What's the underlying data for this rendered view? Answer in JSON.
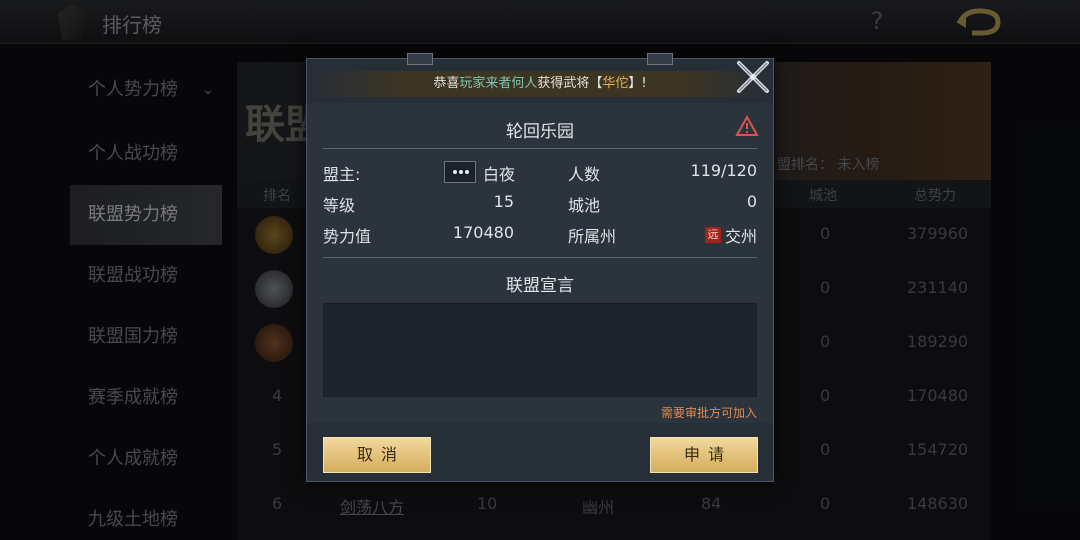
{
  "header": {
    "title": "排行榜",
    "help_label": "?",
    "back_icon": "return-arrow-icon"
  },
  "sidebar": {
    "items": [
      {
        "label": "个人势力榜",
        "active": false
      },
      {
        "label": "个人战功榜",
        "active": false
      },
      {
        "label": "联盟势力榜",
        "active": true
      },
      {
        "label": "联盟战功榜",
        "active": false
      },
      {
        "label": "联盟国力榜",
        "active": false
      },
      {
        "label": "赛季成就榜",
        "active": false
      },
      {
        "label": "个人成就榜",
        "active": false
      },
      {
        "label": "九级土地榜",
        "active": false
      }
    ],
    "chevron": "⌄"
  },
  "banner": {
    "title": "联盟",
    "my_rank": "盟排名： 未入榜"
  },
  "table": {
    "columns": {
      "rank": "排名",
      "city": "城池",
      "total": "总势力"
    },
    "rows": [
      {
        "rank": "",
        "name": "",
        "level": "",
        "region": "",
        "members": "",
        "city": "0",
        "total": "379960"
      },
      {
        "rank": "",
        "name": "",
        "level": "",
        "region": "",
        "members": "",
        "city": "0",
        "total": "231140"
      },
      {
        "rank": "",
        "name": "",
        "level": "",
        "region": "",
        "members": "",
        "city": "0",
        "total": "189290"
      },
      {
        "rank": "4",
        "name": "",
        "level": "",
        "region": "",
        "members": "",
        "city": "0",
        "total": "170480"
      },
      {
        "rank": "5",
        "name": "",
        "level": "",
        "region": "",
        "members": "",
        "city": "0",
        "total": "154720"
      },
      {
        "rank": "6",
        "name": "剑荡八方",
        "level": "10",
        "region": "幽州",
        "members": "84",
        "city": "0",
        "total": "148630"
      }
    ]
  },
  "dialog": {
    "notice": {
      "prefix": "恭喜",
      "player": "玩家来者何人",
      "middle": "获得武将【",
      "general": "华佗",
      "suffix": "】!"
    },
    "alliance_name": "轮回乐园",
    "fields": {
      "leader_label": "盟主:",
      "leader_value": "白夜",
      "members_label": "人数",
      "members_value": "119/120",
      "level_label": "等级",
      "level_value": "15",
      "city_label": "城池",
      "city_value": "0",
      "power_label": "势力值",
      "power_value": "170480",
      "state_label": "所属州",
      "state_badge": "远",
      "state_value": "交州"
    },
    "declaration_title": "联盟宣言",
    "declaration_text": "",
    "approval_note": "需要审批方可加入",
    "cancel_label": "取消",
    "apply_label": "申请"
  },
  "colors": {
    "accent_gold": "#e6b24a",
    "button_gold": "#dcb767",
    "warning_red": "#e0534a",
    "note_orange": "#e08a52"
  }
}
